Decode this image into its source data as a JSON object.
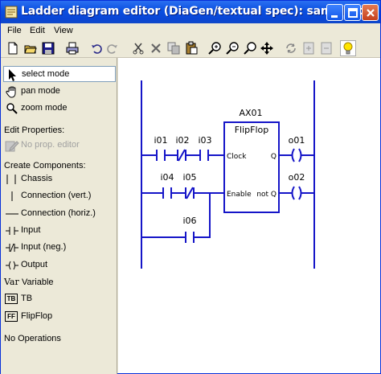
{
  "window": {
    "title": "Ladder diagram editor (DiaGen/textual spec): sample.xml"
  },
  "menu": [
    "File",
    "Edit",
    "View"
  ],
  "toolbar": {
    "tools": [
      "new-file-icon",
      "open-folder-icon",
      "save-icon",
      "print-icon",
      "undo-icon",
      "redo-icon",
      "cut-icon",
      "delete-icon",
      "copy-icon",
      "paste-icon",
      "zoom-in-icon",
      "zoom-out-icon",
      "zoom-reset-icon",
      "pan-move-icon",
      "refresh-icon",
      "export-icon",
      "import-icon",
      "hint-lightbulb-icon"
    ]
  },
  "sidebar": {
    "modes": [
      {
        "label": "select mode",
        "selected": true
      },
      {
        "label": "pan mode",
        "selected": false
      },
      {
        "label": "zoom mode",
        "selected": false
      }
    ],
    "edit_properties_title": "Edit Properties:",
    "no_prop_editor": "No prop. editor",
    "create_components_title": "Create Components:",
    "components": [
      "Chassis",
      "Connection (vert.)",
      "Connection (horiz.)",
      "Input",
      "Input (neg.)",
      "Output",
      "Variable",
      "TB",
      "FlipFlop"
    ],
    "variable_icon_text": "Var",
    "tb_icon_text": "TB",
    "ff_icon_text": "FF",
    "no_operations": "No Operations"
  },
  "diagram": {
    "block_name": "AX01",
    "block_type": "FlipFlop",
    "block_in1": "Clock",
    "block_in2": "Enable",
    "block_out1": "Q",
    "block_out2": "not Q",
    "inputs": [
      "i01",
      "i02",
      "i03",
      "i04",
      "i05",
      "i06"
    ],
    "outputs": [
      "o01",
      "o02"
    ]
  },
  "colors": {
    "diagram_blue": "#1515c8",
    "titlebar_blue": "#0a4fe0",
    "panel_bg": "#ece9d8"
  }
}
